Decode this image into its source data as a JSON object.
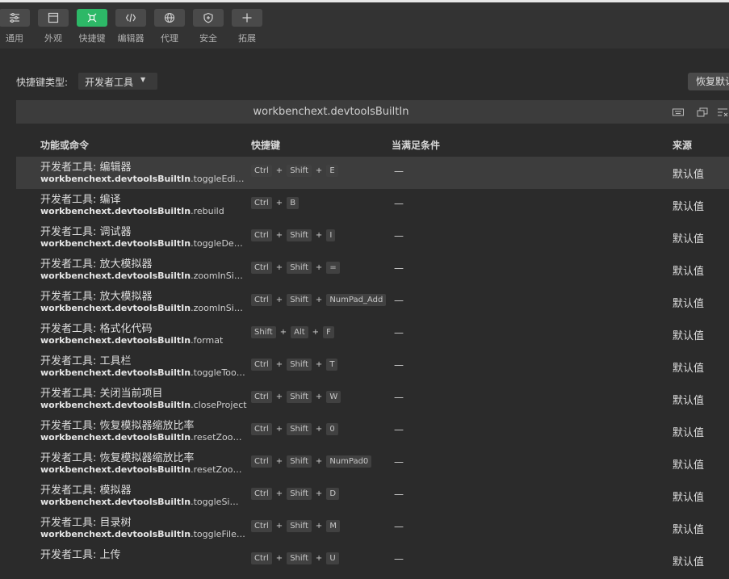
{
  "toolbar": {
    "items": [
      {
        "label": "通用",
        "icon": "sliders-icon"
      },
      {
        "label": "外观",
        "icon": "window-icon"
      },
      {
        "label": "快捷键",
        "icon": "command-icon",
        "active": true
      },
      {
        "label": "编辑器",
        "icon": "code-icon"
      },
      {
        "label": "代理",
        "icon": "globe-icon"
      },
      {
        "label": "安全",
        "icon": "shield-icon"
      },
      {
        "label": "拓展",
        "icon": "plus-icon"
      }
    ],
    "active_color": "#2db867"
  },
  "keybinding_type": {
    "label": "快捷键类型:",
    "value": "开发者工具"
  },
  "reset_button": "恢复默认",
  "extension_bar": {
    "title": "workbenchext.devtoolsBuiltIn"
  },
  "columns": {
    "command": "功能或命令",
    "keybinding": "快捷键",
    "when": "当满足条件",
    "source": "来源"
  },
  "rows": [
    {
      "title": "开发者工具: 编辑器",
      "cmd_prefix": "workbenchext.devtoolsBuiltIn",
      "cmd_suffix": ".toggleEditorWi...",
      "keys": [
        "Ctrl",
        "Shift",
        "E"
      ],
      "when": "—",
      "source": "默认值",
      "selected": true
    },
    {
      "title": "开发者工具: 编译",
      "cmd_prefix": "workbenchext.devtoolsBuiltIn",
      "cmd_suffix": ".rebuild",
      "keys": [
        "Ctrl",
        "B"
      ],
      "when": "—",
      "source": "默认值"
    },
    {
      "title": "开发者工具: 调试器",
      "cmd_prefix": "workbenchext.devtoolsBuiltIn",
      "cmd_suffix": ".toggleDebug...",
      "keys": [
        "Ctrl",
        "Shift",
        "I"
      ],
      "when": "—",
      "source": "默认值"
    },
    {
      "title": "开发者工具: 放大模拟器",
      "cmd_prefix": "workbenchext.devtoolsBuiltIn",
      "cmd_suffix": ".zoomInSimulat...",
      "keys": [
        "Ctrl",
        "Shift",
        "="
      ],
      "when": "—",
      "source": "默认值"
    },
    {
      "title": "开发者工具: 放大模拟器",
      "cmd_prefix": "workbenchext.devtoolsBuiltIn",
      "cmd_suffix": ".zoomInSimulat...",
      "keys": [
        "Ctrl",
        "Shift",
        "NumPad_Add"
      ],
      "when": "—",
      "source": "默认值"
    },
    {
      "title": "开发者工具: 格式化代码",
      "cmd_prefix": "workbenchext.devtoolsBuiltIn",
      "cmd_suffix": ".format",
      "keys": [
        "Shift",
        "Alt",
        "F"
      ],
      "when": "—",
      "source": "默认值"
    },
    {
      "title": "开发者工具: 工具栏",
      "cmd_prefix": "workbenchext.devtoolsBuiltIn",
      "cmd_suffix": ".toggleToolbar",
      "keys": [
        "Ctrl",
        "Shift",
        "T"
      ],
      "when": "—",
      "source": "默认值"
    },
    {
      "title": "开发者工具: 关闭当前项目",
      "cmd_prefix": "workbenchext.devtoolsBuiltIn",
      "cmd_suffix": ".closeProject",
      "keys": [
        "Ctrl",
        "Shift",
        "W"
      ],
      "when": "—",
      "source": "默认值"
    },
    {
      "title": "开发者工具: 恢复模拟器缩放比率",
      "cmd_prefix": "workbenchext.devtoolsBuiltIn",
      "cmd_suffix": ".resetZoomSim...",
      "keys": [
        "Ctrl",
        "Shift",
        "0"
      ],
      "when": "—",
      "source": "默认值"
    },
    {
      "title": "开发者工具: 恢复模拟器缩放比率",
      "cmd_prefix": "workbenchext.devtoolsBuiltIn",
      "cmd_suffix": ".resetZoomSim...",
      "keys": [
        "Ctrl",
        "Shift",
        "NumPad0"
      ],
      "when": "—",
      "source": "默认值"
    },
    {
      "title": "开发者工具: 模拟器",
      "cmd_prefix": "workbenchext.devtoolsBuiltIn",
      "cmd_suffix": ".toggleSimulat...",
      "keys": [
        "Ctrl",
        "Shift",
        "D"
      ],
      "when": "—",
      "source": "默认值"
    },
    {
      "title": "开发者工具: 目录树",
      "cmd_prefix": "workbenchext.devtoolsBuiltIn",
      "cmd_suffix": ".toggleFileTree",
      "keys": [
        "Ctrl",
        "Shift",
        "M"
      ],
      "when": "—",
      "source": "默认值"
    },
    {
      "title": "开发者工具: 上传",
      "cmd_prefix": "",
      "cmd_suffix": "",
      "keys": [
        "Ctrl",
        "Shift",
        "U"
      ],
      "when": "—",
      "source": "默认值"
    }
  ]
}
